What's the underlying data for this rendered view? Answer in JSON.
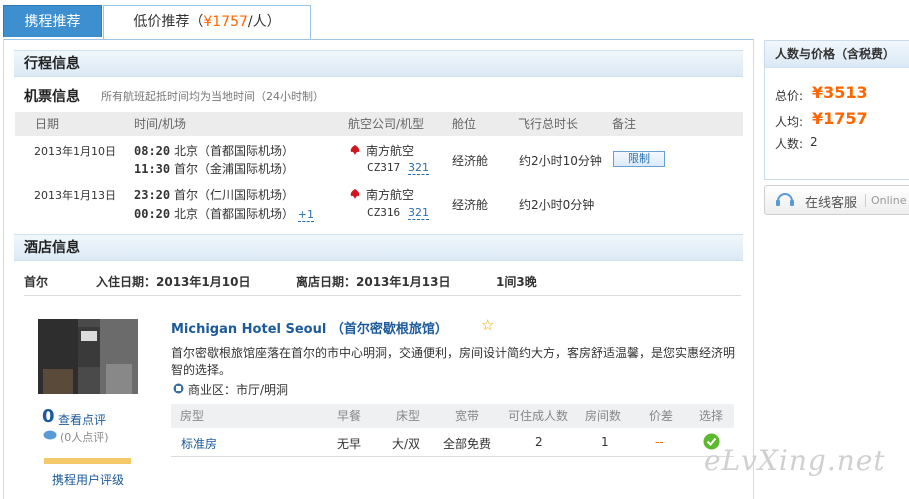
{
  "tabs": {
    "tab1": "携程推荐",
    "tab2_label": "低价推荐（",
    "tab2_price": "¥1757",
    "tab2_suffix": "/人）"
  },
  "itinerary": {
    "title": "行程信息",
    "ticket_title": "机票信息",
    "ticket_note": "所有航班起抵时间均为当地时间（24小时制）",
    "headers": [
      "日期",
      "时间/机场",
      "航空公司/机型",
      "舱位",
      "飞行总时长",
      "备注"
    ],
    "flights": [
      {
        "date": "2013年1月10日",
        "dep_time": "08:20",
        "dep_airport": "北京（首都国际机场）",
        "arr_time": "11:30",
        "arr_airport": "首尔（金浦国际机场）",
        "next_day": "",
        "airline": "南方航空",
        "flight_no": "CZ317",
        "model": "321",
        "cabin": "经济舱",
        "duration": "约2小时10分钟",
        "remark": "限制"
      },
      {
        "date": "2013年1月13日",
        "dep_time": "23:20",
        "dep_airport": "首尔（仁川国际机场）",
        "arr_time": "00:20",
        "arr_airport": "北京（首都国际机场）",
        "next_day": "+1",
        "airline": "南方航空",
        "flight_no": "CZ316",
        "model": "321",
        "cabin": "经济舱",
        "duration": "约2小时0分钟",
        "remark": ""
      }
    ]
  },
  "hotel_section": {
    "title": "酒店信息",
    "city": "首尔",
    "checkin": "入住日期：2013年1月10日",
    "checkout": "离店日期：2013年1月13日",
    "rooms_nights": "1间3晚",
    "hotel_name": "Michigan Hotel Seoul （首尔密歇根旅馆）",
    "description": "首尔密歇根旅馆座落在首尔的市中心明洞，交通便利，房间设计简约大方，客房舒适温馨，是您实惠经济明智的选择。",
    "district": "商业区：市厅/明洞",
    "review_count": "0",
    "review_link": "查看点评",
    "review_people": "(0人点评)",
    "rating_label": "携程用户评级",
    "room_headers": [
      "房型",
      "早餐",
      "床型",
      "宽带",
      "可住成人数",
      "房间数",
      "价差",
      "选择"
    ],
    "room": {
      "type": "标准房",
      "breakfast": "无早",
      "bed": "大/双",
      "internet": "全部免费",
      "adults": "2",
      "rooms": "1",
      "diff": "--"
    }
  },
  "sidebar": {
    "title": "人数与价格（含税费）",
    "total_label": "总价:",
    "total_value": "¥3513",
    "per_label": "人均:",
    "per_value": "¥1757",
    "people_label": "人数:",
    "people_value": "2",
    "service_label": "在线客服",
    "service_online": "Online S"
  },
  "watermark": "eLvXing.net",
  "colors": {
    "accent": "#ff6600",
    "tab_active": "#3d8fcf",
    "link": "#1d5a9a"
  }
}
